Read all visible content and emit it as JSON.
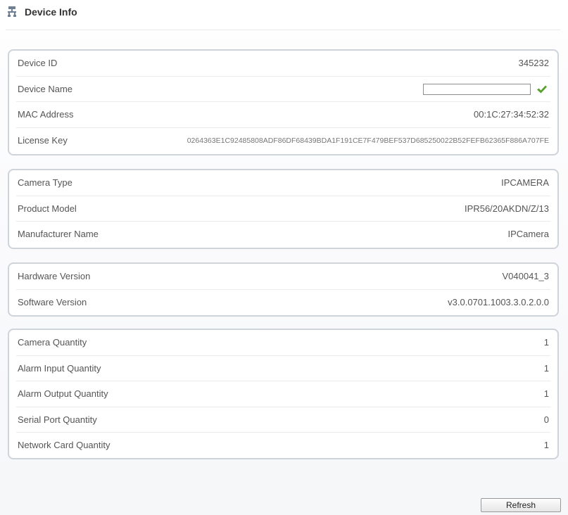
{
  "header": {
    "title": "Device Info",
    "icon": "device-tree-icon"
  },
  "colors": {
    "card_border": "#cfd3da",
    "check_green": "#5aa02c",
    "text": "#555555"
  },
  "device": {
    "device_id_label": "Device ID",
    "device_id_value": "345232",
    "device_name_label": "Device Name",
    "device_name_value": "",
    "device_name_confirm_icon": "checkmark-icon",
    "mac_label": "MAC Address",
    "mac_value": "00:1C:27:34:52:32",
    "license_label": "License Key",
    "license_value": "0264363E1C92485808ADF86DF68439BDA1F191CE7F479BEF537D685250022B52FEFB62365F886A707FE"
  },
  "product": {
    "camera_type_label": "Camera Type",
    "camera_type_value": "IPCAMERA",
    "model_label": "Product Model",
    "model_value": "IPR56/20AKDN/Z/13",
    "manufacturer_label": "Manufacturer Name",
    "manufacturer_value": "IPCamera"
  },
  "versions": {
    "hardware_label": "Hardware Version",
    "hardware_value": "V040041_3",
    "software_label": "Software Version",
    "software_value": "v3.0.0701.1003.3.0.2.0.0"
  },
  "quantities": {
    "camera_label": "Camera Quantity",
    "camera_value": "1",
    "alarm_in_label": "Alarm Input Quantity",
    "alarm_in_value": "1",
    "alarm_out_label": "Alarm Output Quantity",
    "alarm_out_value": "1",
    "serial_label": "Serial Port Quantity",
    "serial_value": "0",
    "network_label": "Network Card Quantity",
    "network_value": "1"
  },
  "footer": {
    "refresh_label": "Refresh"
  }
}
